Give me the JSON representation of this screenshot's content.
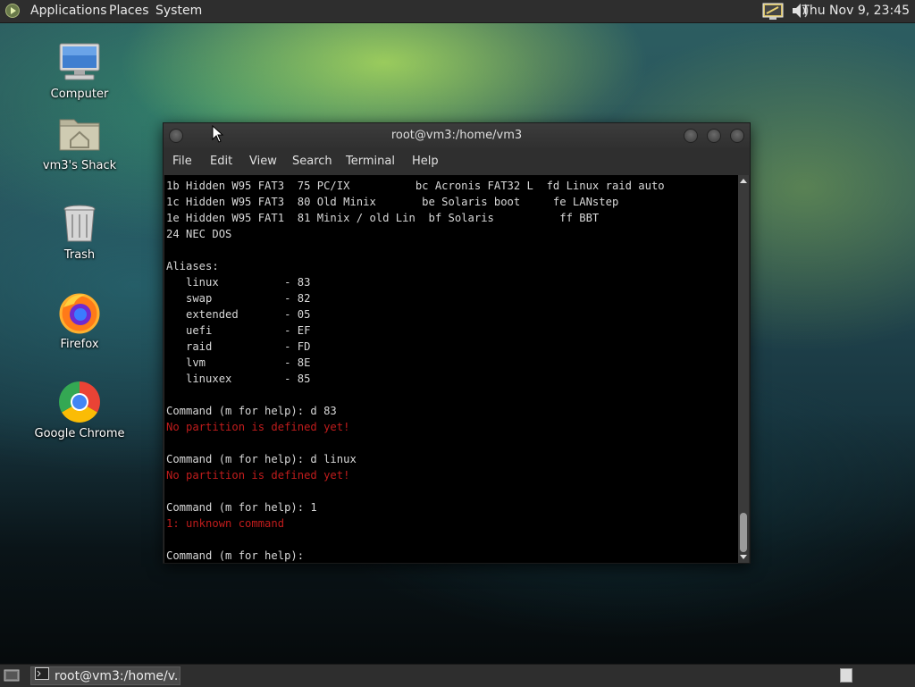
{
  "top_panel": {
    "menus": [
      "Applications",
      "Places",
      "System"
    ],
    "clock": "Thu Nov 9, 23:45",
    "tray_icons": [
      "display-icon",
      "volume-icon"
    ]
  },
  "desktop_icons": [
    {
      "label": "Computer",
      "icon": "computer-icon"
    },
    {
      "label": "vm3's Shack",
      "icon": "home-folder-icon"
    },
    {
      "label": "Trash",
      "icon": "trash-icon"
    },
    {
      "label": "Firefox",
      "icon": "firefox-icon"
    },
    {
      "label": "Google Chrome",
      "icon": "chrome-icon"
    }
  ],
  "terminal": {
    "title": "root@vm3:/home/vm3",
    "menu": [
      "File",
      "Edit",
      "View",
      "Search",
      "Terminal",
      "Help"
    ],
    "lines": [
      {
        "text": "1b Hidden W95 FAT3  75 PC/IX          bc Acronis FAT32 L  fd Linux raid auto",
        "error": false
      },
      {
        "text": "1c Hidden W95 FAT3  80 Old Minix       be Solaris boot     fe LANstep",
        "error": false
      },
      {
        "text": "1e Hidden W95 FAT1  81 Minix / old Lin  bf Solaris          ff BBT",
        "error": false
      },
      {
        "text": "24 NEC DOS",
        "error": false
      },
      {
        "text": "",
        "error": false
      },
      {
        "text": "Aliases:",
        "error": false
      },
      {
        "text": "   linux          - 83",
        "error": false
      },
      {
        "text": "   swap           - 82",
        "error": false
      },
      {
        "text": "   extended       - 05",
        "error": false
      },
      {
        "text": "   uefi           - EF",
        "error": false
      },
      {
        "text": "   raid           - FD",
        "error": false
      },
      {
        "text": "   lvm            - 8E",
        "error": false
      },
      {
        "text": "   linuxex        - 85",
        "error": false
      },
      {
        "text": "",
        "error": false
      },
      {
        "text": "Command (m for help): d 83",
        "error": false
      },
      {
        "text": "No partition is defined yet!",
        "error": true
      },
      {
        "text": "",
        "error": false
      },
      {
        "text": "Command (m for help): d linux",
        "error": false
      },
      {
        "text": "No partition is defined yet!",
        "error": true
      },
      {
        "text": "",
        "error": false
      },
      {
        "text": "Command (m for help): 1",
        "error": false
      },
      {
        "text": "1: unknown command",
        "error": true
      },
      {
        "text": "",
        "error": false
      },
      {
        "text": "Command (m for help): ",
        "error": false
      }
    ]
  },
  "bottom_panel": {
    "task_label": "root@vm3:/home/v..."
  },
  "colors": {
    "error_text": "#c01c1c",
    "terminal_bg": "#000000",
    "panel_bg": "#2e2e2e"
  }
}
